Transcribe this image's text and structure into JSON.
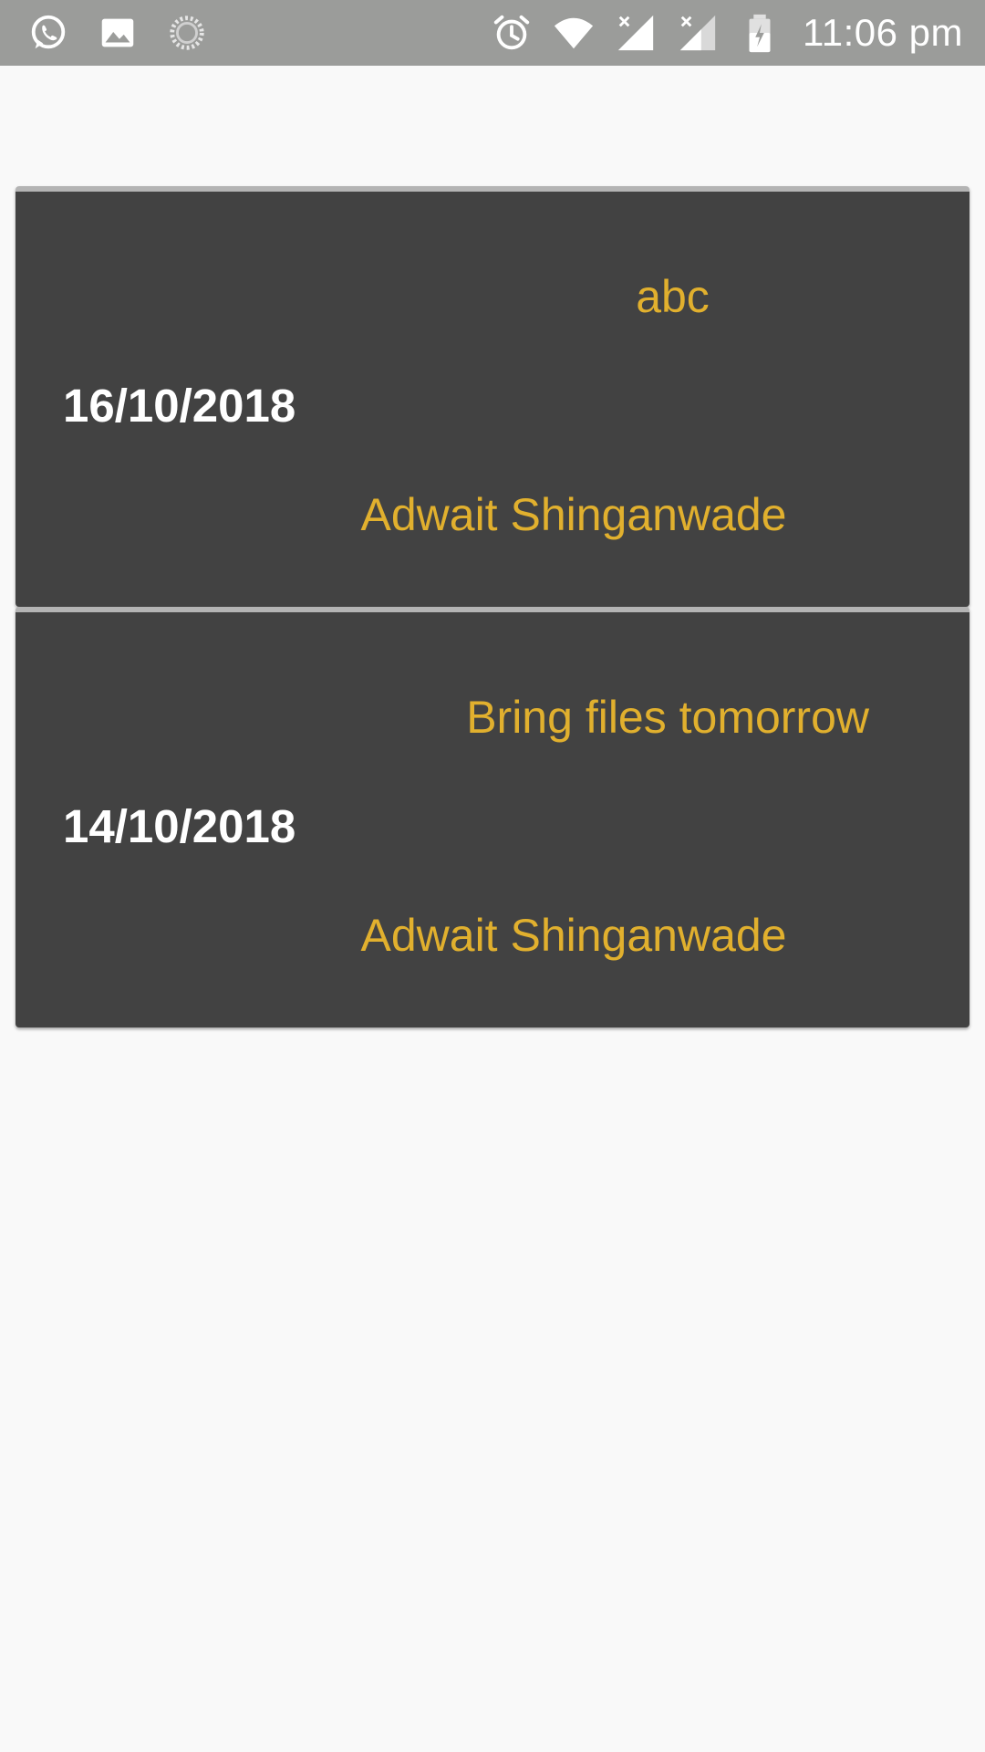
{
  "status_bar": {
    "left_icons": [
      "whatsapp-icon",
      "image-icon",
      "loading-icon"
    ],
    "right_icons": [
      "alarm-icon",
      "wifi-icon",
      "signal-x-icon",
      "signal-x-icon-2",
      "battery-charging-icon"
    ],
    "time": "11:06 pm"
  },
  "messages": [
    {
      "text": "abc",
      "date": "16/10/2018",
      "sender": "Adwait Shinganwade"
    },
    {
      "text": "Bring files tomorrow",
      "date": "14/10/2018",
      "sender": "Adwait Shinganwade"
    }
  ],
  "colors": {
    "status_bar_bg": "#9b9c9a",
    "page_bg": "#f9f9f9",
    "card_bg": "#424242",
    "accent_text": "#e1b02e",
    "date_text": "#ffffff"
  }
}
